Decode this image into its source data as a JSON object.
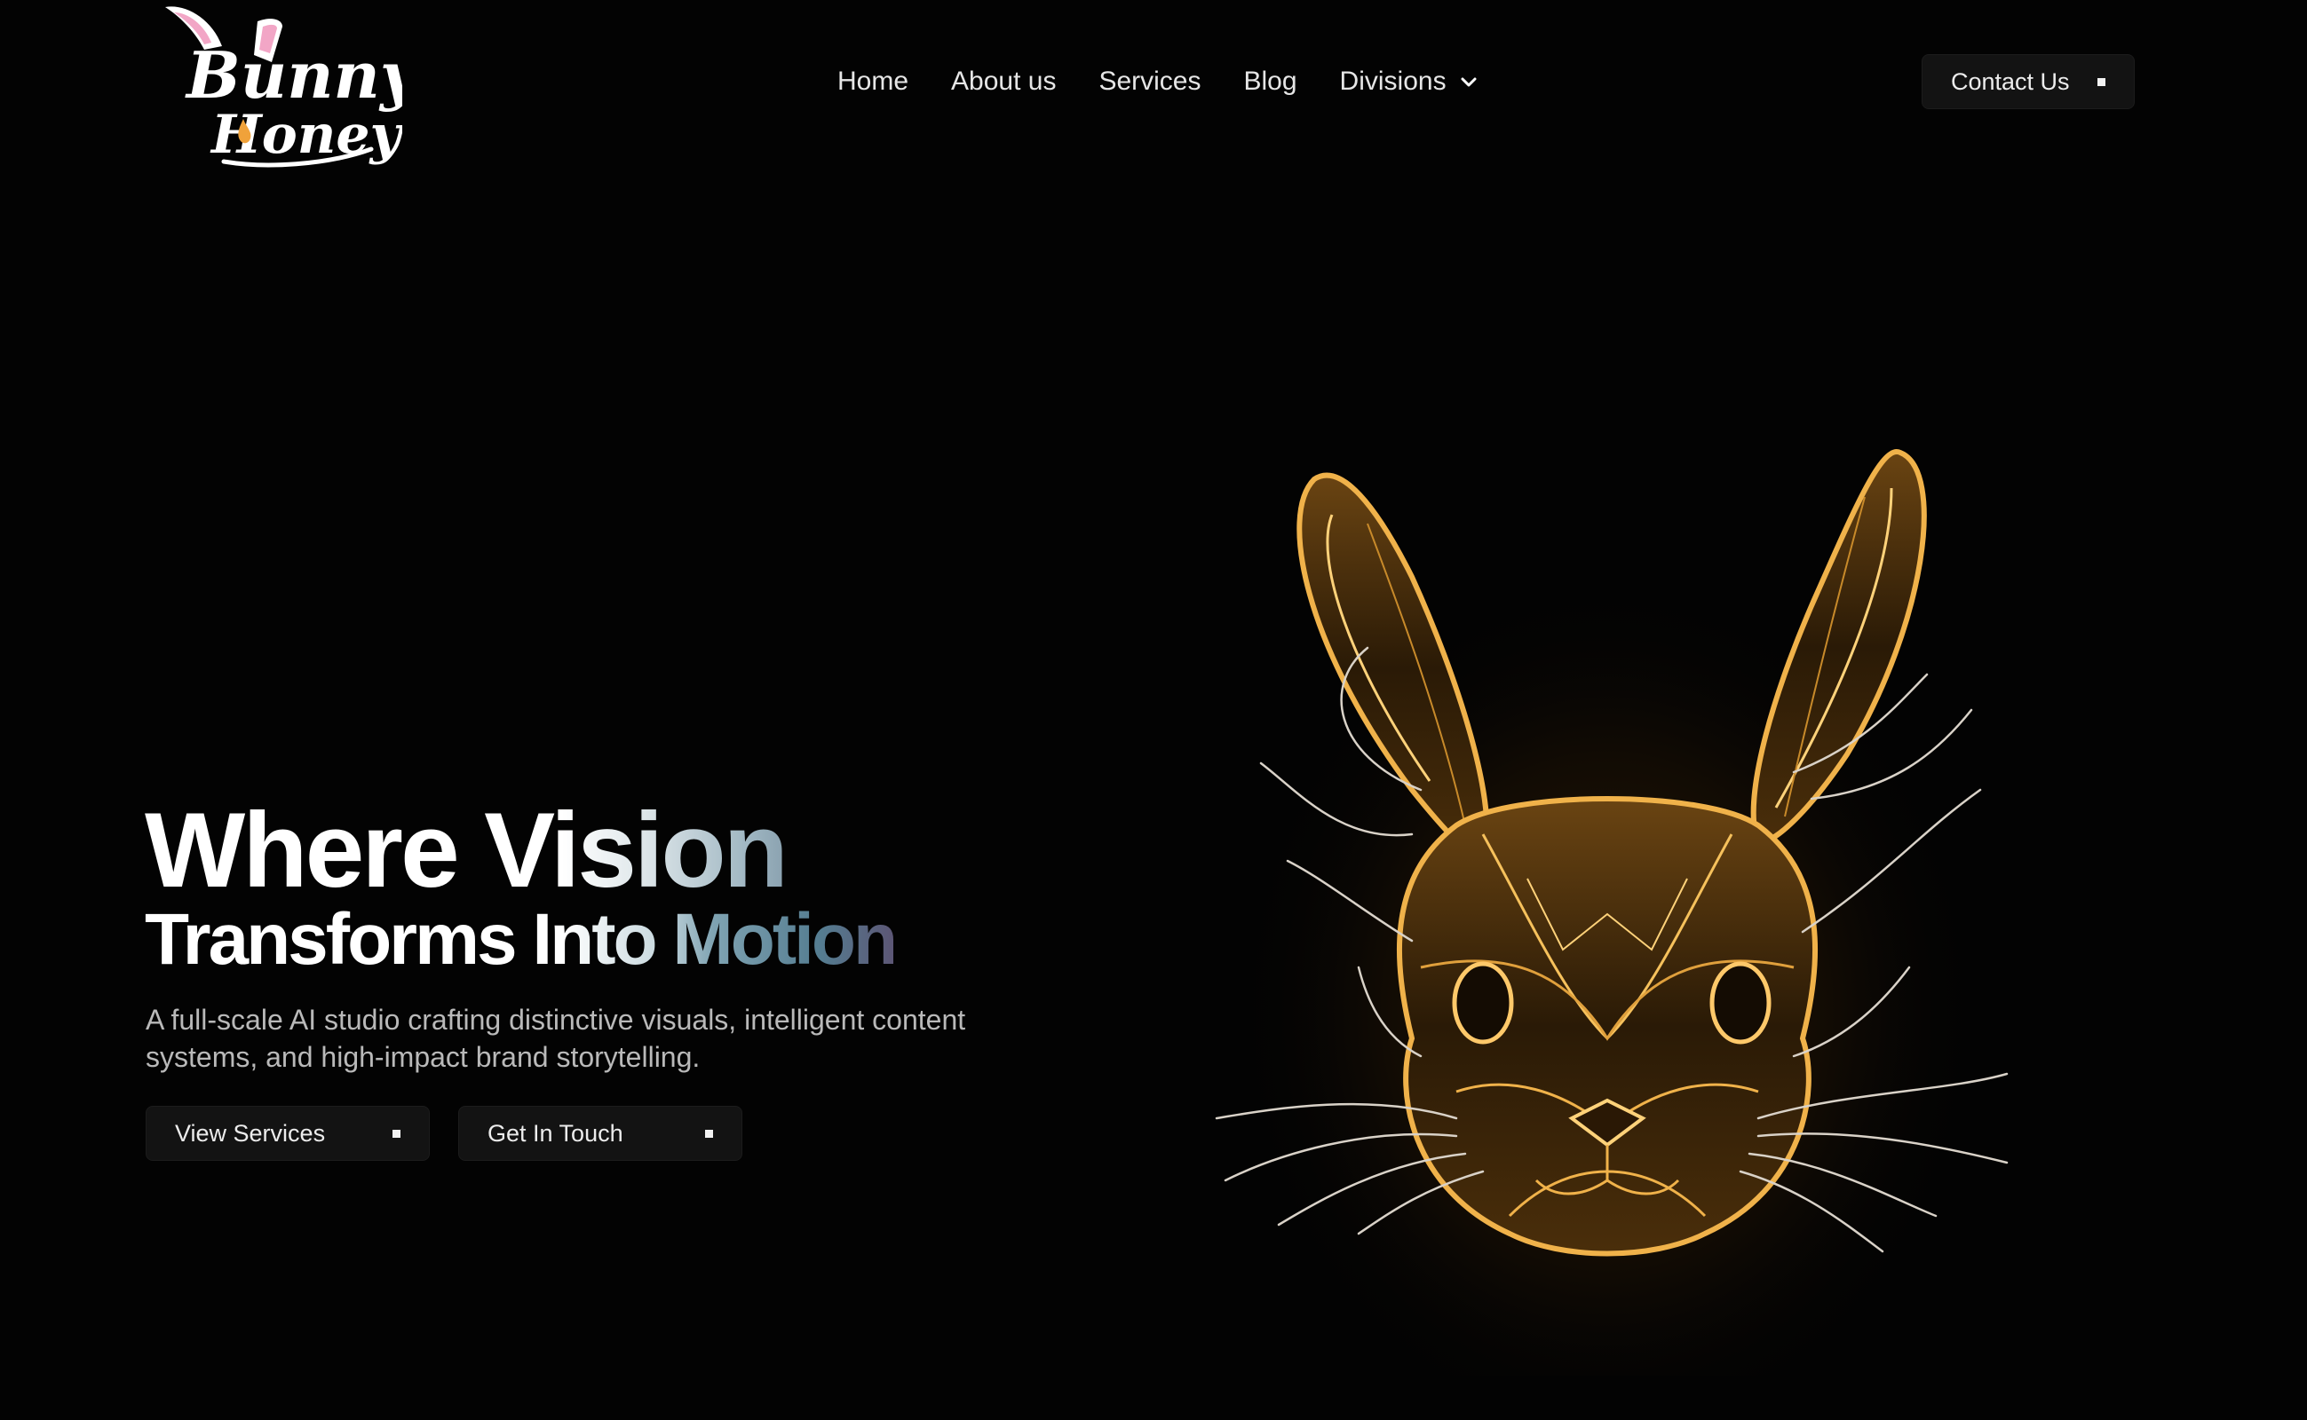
{
  "header": {
    "logo": {
      "line1": "Bunny",
      "line2": "Honey"
    },
    "nav": [
      {
        "label": "Home"
      },
      {
        "label": "About us"
      },
      {
        "label": "Services"
      },
      {
        "label": "Blog"
      },
      {
        "label": "Divisions",
        "icon": "chevron-down-icon"
      }
    ],
    "contact_label": "Contact Us"
  },
  "hero": {
    "title_line1": "Where Vision",
    "title_line2": "Transforms Into Motion",
    "subtitle": "A full-scale AI studio crafting distinctive visuals, intelligent content systems, and high-impact brand storytelling.",
    "primary_button": "View Services",
    "secondary_button": "Get In Touch",
    "illustration": "golden-glass-rabbit-head"
  },
  "colors": {
    "background": "#030303",
    "button_bg": "#131313",
    "gold": "#f0b24a",
    "subtitle": "#b9b9b9"
  }
}
